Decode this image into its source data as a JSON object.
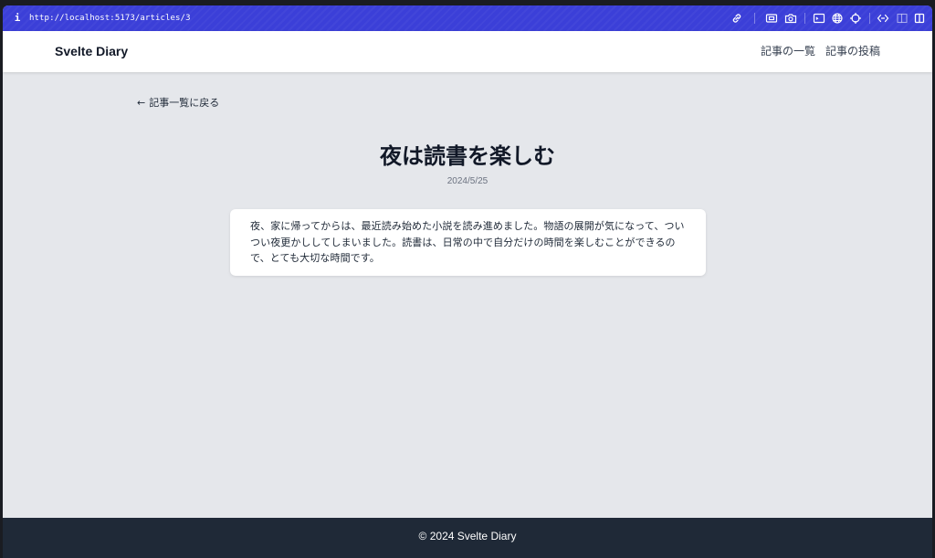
{
  "browser": {
    "url": "http://localhost:5173/articles/3",
    "info_icon": "i",
    "icons": [
      "link-icon",
      "screenshot-icon",
      "camera-icon",
      "terminal-icon",
      "globe-icon",
      "crosshair-icon",
      "code-icon",
      "panel-icon",
      "split-view-icon"
    ]
  },
  "header": {
    "brand": "Svelte Diary",
    "nav": [
      "記事の一覧",
      "記事の投稿"
    ]
  },
  "main": {
    "back_arrow": "←",
    "back_label": "記事一覧に戻る",
    "title": "夜は読書を楽しむ",
    "date": "2024/5/25",
    "body": "夜、家に帰ってからは、最近読み始めた小説を読み進めました。物語の展開が気になって、ついつい夜更かししてしまいました。読書は、日常の中で自分だけの時間を楽しむことができるので、とても大切な時間です。"
  },
  "footer": {
    "copyright": "© 2024 Svelte Diary"
  },
  "colors": {
    "toolbar": "#3b3fd8",
    "background": "#e5e7eb",
    "footer": "#1f2937"
  }
}
